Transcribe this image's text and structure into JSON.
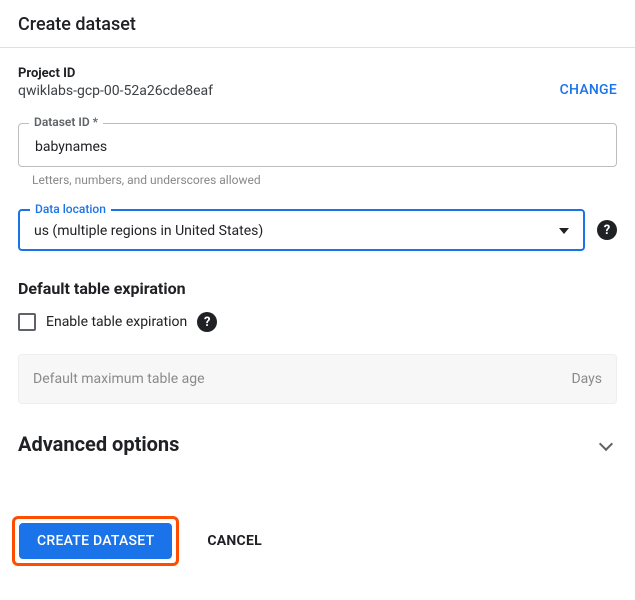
{
  "header": {
    "title": "Create dataset"
  },
  "project": {
    "label": "Project ID",
    "value": "qwiklabs-gcp-00-52a26cde8eaf",
    "change_label": "CHANGE"
  },
  "dataset_id": {
    "label": "Dataset ID *",
    "value": "babynames",
    "helper": "Letters, numbers, and underscores allowed"
  },
  "location": {
    "label": "Data location",
    "value": "us (multiple regions in United States)"
  },
  "expiration": {
    "title": "Default table expiration",
    "checkbox_label": "Enable table expiration",
    "max_age_placeholder": "Default maximum table age",
    "unit": "Days"
  },
  "advanced": {
    "title": "Advanced options"
  },
  "actions": {
    "create": "CREATE DATASET",
    "cancel": "CANCEL"
  },
  "icons": {
    "help_glyph": "?"
  }
}
